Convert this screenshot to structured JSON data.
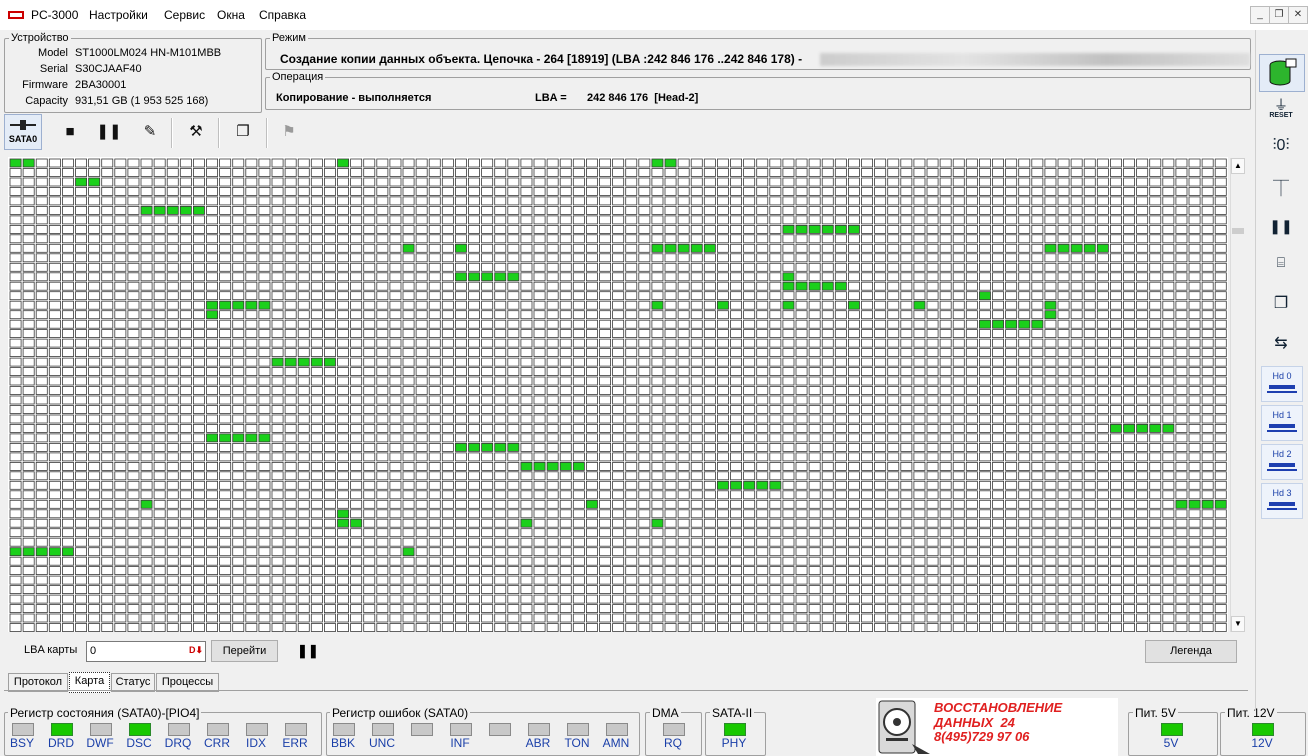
{
  "app": {
    "title": "PC-3000"
  },
  "menu": [
    "Настройки",
    "Сервис",
    "Окна",
    "Справка"
  ],
  "device": {
    "group_label": "Устройство",
    "fields": [
      {
        "key": "Model",
        "value": "ST1000LM024 HN-M101MBB"
      },
      {
        "key": "Serial",
        "value": "S30CJAAF40"
      },
      {
        "key": "Firmware",
        "value": "2BA30001"
      },
      {
        "key": "Capacity",
        "value": "931,51 GB (1 953 525 168)"
      }
    ]
  },
  "mode": {
    "group_label": "Режим",
    "text": "Создание копии данных объекта. Цепочка - 264 [18919] (LBA :242 846 176 ..242 846 178) -"
  },
  "operation": {
    "group_label": "Операция",
    "status": "Копирование - выполняется",
    "lba_label": "LBA =",
    "lba_value": "242 846 176  [Head-2]"
  },
  "toolbar": {
    "sata_label": "SATA0"
  },
  "map": {
    "cols": 93,
    "rows": 50,
    "filled_color": "#1bd01b",
    "empty_color": "#ffffff",
    "border_color": "#3a3a3a",
    "filled_runs": [
      [
        0,
        0,
        2
      ],
      [
        0,
        25,
        1
      ],
      [
        0,
        49,
        2
      ],
      [
        2,
        5,
        2
      ],
      [
        5,
        10,
        5
      ],
      [
        7,
        59,
        6
      ],
      [
        9,
        30,
        1
      ],
      [
        9,
        34,
        1
      ],
      [
        9,
        49,
        5
      ],
      [
        9,
        79,
        5
      ],
      [
        12,
        34,
        5
      ],
      [
        12,
        59,
        1
      ],
      [
        12,
        59,
        1
      ],
      [
        13,
        59,
        5
      ],
      [
        14,
        74,
        1
      ],
      [
        15,
        15,
        5
      ],
      [
        15,
        49,
        1
      ],
      [
        15,
        54,
        1
      ],
      [
        15,
        59,
        1
      ],
      [
        15,
        64,
        1
      ],
      [
        15,
        69,
        1
      ],
      [
        15,
        79,
        1
      ],
      [
        16,
        15,
        1
      ],
      [
        16,
        79,
        1
      ],
      [
        17,
        74,
        5
      ],
      [
        21,
        20,
        5
      ],
      [
        28,
        84,
        5
      ],
      [
        29,
        15,
        5
      ],
      [
        30,
        34,
        5
      ],
      [
        32,
        39,
        5
      ],
      [
        34,
        54,
        5
      ],
      [
        36,
        10,
        1
      ],
      [
        36,
        44,
        1
      ],
      [
        36,
        89,
        5
      ],
      [
        37,
        25,
        1
      ],
      [
        38,
        25,
        2
      ],
      [
        38,
        39,
        1
      ],
      [
        38,
        49,
        1
      ],
      [
        41,
        0,
        5
      ],
      [
        41,
        30,
        1
      ]
    ]
  },
  "lba_map": {
    "label": "LBA карты",
    "value": "0",
    "goto_label": "Перейти",
    "legend_label": "Легенда"
  },
  "tabs": [
    {
      "label": "Протокол",
      "active": false
    },
    {
      "label": "Карта",
      "active": true
    },
    {
      "label": "Статус",
      "active": false
    },
    {
      "label": "Процессы",
      "active": false
    }
  ],
  "status_register": {
    "label": "Регистр состояния (SATA0)-[PIO4]",
    "bits": [
      {
        "name": "BSY",
        "on": false
      },
      {
        "name": "DRD",
        "on": true
      },
      {
        "name": "DWF",
        "on": false
      },
      {
        "name": "DSC",
        "on": true
      },
      {
        "name": "DRQ",
        "on": false
      },
      {
        "name": "CRR",
        "on": false
      },
      {
        "name": "IDX",
        "on": false
      },
      {
        "name": "ERR",
        "on": false
      }
    ]
  },
  "error_register": {
    "label": "Регистр ошибок  (SATA0)",
    "bits": [
      {
        "name": "BBK",
        "on": false
      },
      {
        "name": "UNC",
        "on": false
      },
      {
        "name": "",
        "on": false
      },
      {
        "name": "INF",
        "on": false
      },
      {
        "name": "",
        "on": false
      },
      {
        "name": "ABR",
        "on": false
      },
      {
        "name": "TON",
        "on": false
      },
      {
        "name": "AMN",
        "on": false
      }
    ]
  },
  "dma": {
    "label": "DMA",
    "bit": "RQ"
  },
  "sata": {
    "label": "SATA-II",
    "bit": "PHY"
  },
  "banner": {
    "line1": "ВОССТАНОВЛЕНИЕ",
    "line2": "ДАННЫХ  24",
    "phone": "8(495)729 97 06"
  },
  "power5": {
    "label": "Пит. 5V",
    "value": "5V"
  },
  "power12": {
    "label": "Пит. 12V",
    "value": "12V"
  },
  "right_tools": {
    "reset_label": "RESET",
    "hd_buttons": [
      "Hd 0",
      "Hd 1",
      "Hd 2",
      "Hd 3"
    ]
  }
}
